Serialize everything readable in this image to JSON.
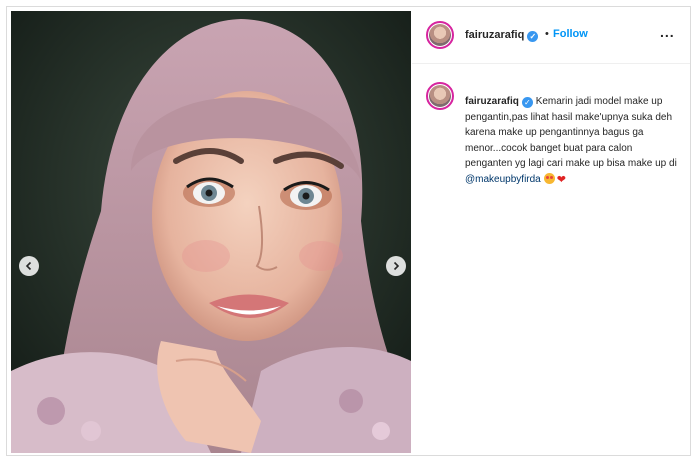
{
  "post": {
    "author": {
      "username": "fairuzarafiq",
      "verified": true,
      "verified_icon": "verified-badge-icon"
    },
    "header": {
      "separator": "•",
      "follow_label": "Follow",
      "more_label": "..."
    },
    "caption": {
      "username": "fairuzarafiq",
      "text": "Kemarin jadi model make up pengantin,pas lihat hasil make'upnya suka deh karena make up pengantinnya bagus ga menor...cocok banget buat para calon penganten yg lagi cari make up bisa make up di ",
      "mention": "@makeupbyfirda",
      "emojis": [
        "star-struck-emoji",
        "red-heart-emoji"
      ]
    },
    "carousel": {
      "prev_icon": "chevron-left-icon",
      "next_icon": "chevron-right-icon"
    }
  },
  "colors": {
    "follow": "#0095f6",
    "verified": "#3897f0",
    "mention": "#00376b",
    "border": "#dbdbdb"
  }
}
